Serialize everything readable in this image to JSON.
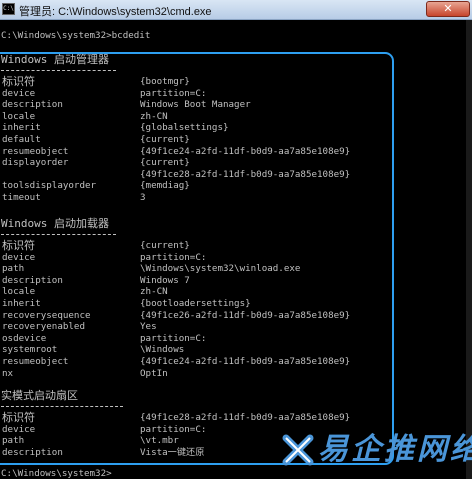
{
  "window": {
    "title": "管理员: C:\\Windows\\system32\\cmd.exe",
    "icon_label": "C:\\",
    "close_label": "✕"
  },
  "prompt": {
    "command_line": "C:\\Windows\\system32>bcdedit",
    "last_line": "C:\\Windows\\system32>"
  },
  "boot_manager": {
    "header": "Windows 启动管理器",
    "rows": [
      {
        "k": "标识符",
        "v": "{bootmgr}"
      },
      {
        "k": "device",
        "v": "partition=C:"
      },
      {
        "k": "description",
        "v": "Windows Boot Manager"
      },
      {
        "k": "locale",
        "v": "zh-CN"
      },
      {
        "k": "inherit",
        "v": "{globalsettings}"
      },
      {
        "k": "default",
        "v": "{current}"
      },
      {
        "k": "resumeobject",
        "v": "{49f1ce24-a2fd-11df-b0d9-aa7a85e108e9}"
      },
      {
        "k": "displayorder",
        "v": "{current}"
      },
      {
        "k": "",
        "v": "{49f1ce28-a2fd-11df-b0d9-aa7a85e108e9}"
      },
      {
        "k": "toolsdisplayorder",
        "v": "{memdiag}"
      },
      {
        "k": "timeout",
        "v": "3"
      }
    ]
  },
  "boot_loader": {
    "header": "Windows 启动加载器",
    "rows": [
      {
        "k": "标识符",
        "v": "{current}"
      },
      {
        "k": "device",
        "v": "partition=C:"
      },
      {
        "k": "path",
        "v": "\\Windows\\system32\\winload.exe"
      },
      {
        "k": "description",
        "v": "Windows 7"
      },
      {
        "k": "locale",
        "v": "zh-CN"
      },
      {
        "k": "inherit",
        "v": "{bootloadersettings}"
      },
      {
        "k": "recoverysequence",
        "v": "{49f1ce26-a2fd-11df-b0d9-aa7a85e108e9}"
      },
      {
        "k": "recoveryenabled",
        "v": "Yes"
      },
      {
        "k": "osdevice",
        "v": "partition=C:"
      },
      {
        "k": "systemroot",
        "v": "\\Windows"
      },
      {
        "k": "resumeobject",
        "v": "{49f1ce24-a2fd-11df-b0d9-aa7a85e108e9}"
      },
      {
        "k": "nx",
        "v": "OptIn"
      }
    ]
  },
  "real_mode": {
    "header": "实模式启动扇区",
    "rows": [
      {
        "k": "标识符",
        "v": "{49f1ce28-a2fd-11df-b0d9-aa7a85e108e9}"
      },
      {
        "k": "device",
        "v": "partition=C:"
      },
      {
        "k": "path",
        "v": "\\vt.mbr"
      },
      {
        "k": "description",
        "v": "Vista一键还原"
      }
    ]
  },
  "watermark": {
    "text": "易企推网络"
  },
  "colors": {
    "console_text": "#c0c0c0",
    "console_bg": "#000000",
    "highlight": "#2e9ff0",
    "watermark": "#4a95d8"
  }
}
